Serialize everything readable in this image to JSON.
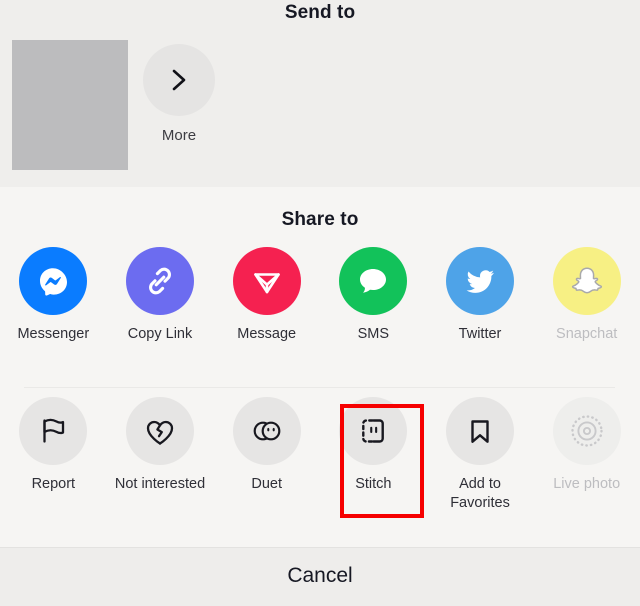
{
  "send_to": {
    "title": "Send to",
    "contact_placeholder": "contact-thumbnail-placeholder",
    "more": {
      "label": "More",
      "icon": "chevron-right-icon"
    }
  },
  "share": {
    "title": "Share to",
    "items": [
      {
        "label": "Messenger",
        "icon": "messenger-icon",
        "color": "#0a7cff",
        "disabled": false
      },
      {
        "label": "Copy Link",
        "icon": "link-icon",
        "color": "#6c6cf0",
        "disabled": false
      },
      {
        "label": "Message",
        "icon": "send-plane-icon",
        "color": "#f52150",
        "disabled": false
      },
      {
        "label": "SMS",
        "icon": "chat-bubble-icon",
        "color": "#12c25a",
        "disabled": false
      },
      {
        "label": "Twitter",
        "icon": "twitter-bird-icon",
        "color": "#4ea3e8",
        "disabled": false
      },
      {
        "label": "Snapchat",
        "icon": "snapchat-ghost-icon",
        "color": "#f7f084",
        "disabled": true
      }
    ]
  },
  "actions": {
    "items": [
      {
        "label": "Report",
        "icon": "flag-icon",
        "disabled": false
      },
      {
        "label": "Not interested",
        "icon": "broken-heart-icon",
        "disabled": false
      },
      {
        "label": "Duet",
        "icon": "duet-circles-icon",
        "disabled": false
      },
      {
        "label": "Stitch",
        "icon": "stitch-icon",
        "disabled": false,
        "highlighted": true
      },
      {
        "label": "Add to Favorites",
        "icon": "bookmark-icon",
        "disabled": false
      },
      {
        "label": "Live photo",
        "icon": "live-photo-icon",
        "disabled": true
      }
    ]
  },
  "cancel": {
    "label": "Cancel"
  },
  "colors": {
    "highlight": "#f60000",
    "section_top_bg": "#efeeec",
    "section_share_bg": "#f6f5f3",
    "cancel_bg": "#eeedeb",
    "icon_circle_gray": "#e6e5e4",
    "text_primary": "#161823",
    "text_dim": "#bdbdc0"
  }
}
